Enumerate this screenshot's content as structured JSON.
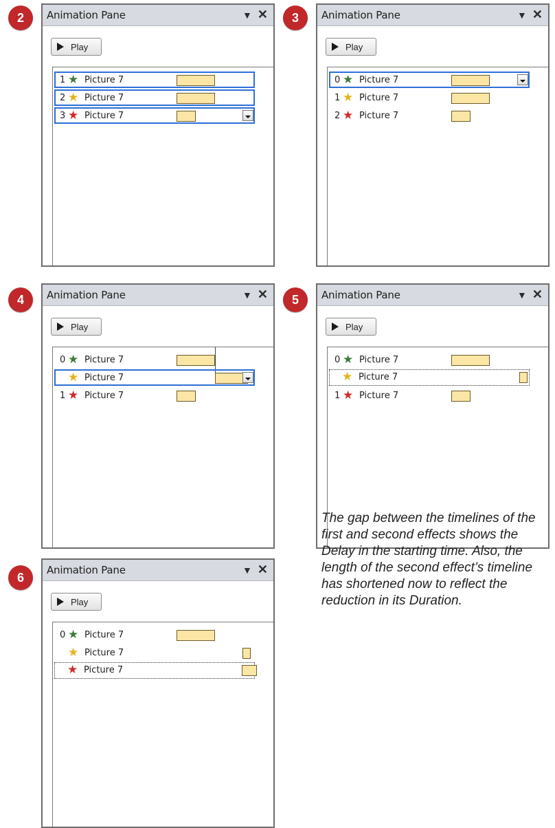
{
  "pane": {
    "title": "Animation Pane",
    "menu_icon": "▼",
    "close_icon": "✕",
    "play_label": "Play",
    "item_label": "Picture 7"
  },
  "steps": [
    "2",
    "3",
    "4",
    "5",
    "6"
  ],
  "panels": [
    {
      "step": "2",
      "rows": [
        {
          "num": "1",
          "star": "green",
          "sel": "blue",
          "dropdown": false
        },
        {
          "num": "2",
          "star": "gold",
          "sel": "blue",
          "dropdown": false
        },
        {
          "num": "3",
          "star": "red",
          "sel": "blue",
          "dropdown": true
        }
      ]
    },
    {
      "step": "3",
      "rows": [
        {
          "num": "0",
          "star": "green",
          "sel": "blue",
          "dropdown": true
        },
        {
          "num": "1",
          "star": "gold",
          "sel": "none",
          "dropdown": false
        },
        {
          "num": "2",
          "star": "red",
          "sel": "none",
          "dropdown": false
        }
      ]
    },
    {
      "step": "4",
      "rows": [
        {
          "num": "0",
          "star": "green",
          "sel": "none",
          "dropdown": false
        },
        {
          "num": "",
          "star": "gold",
          "sel": "blue",
          "dropdown": true
        },
        {
          "num": "1",
          "star": "red",
          "sel": "none",
          "dropdown": false
        }
      ]
    },
    {
      "step": "5",
      "rows": [
        {
          "num": "0",
          "star": "green",
          "sel": "none",
          "dropdown": false
        },
        {
          "num": "",
          "star": "gold",
          "sel": "dotted",
          "dropdown": false
        },
        {
          "num": "1",
          "star": "red",
          "sel": "none",
          "dropdown": false
        }
      ]
    },
    {
      "step": "6",
      "rows": [
        {
          "num": "0",
          "star": "green",
          "sel": "none",
          "dropdown": false
        },
        {
          "num": "",
          "star": "gold",
          "sel": "none",
          "dropdown": false
        },
        {
          "num": "",
          "star": "red",
          "sel": "dotted",
          "dropdown": false
        }
      ]
    }
  ],
  "caption": "The gap between the timelines of the first and second effects shows the Delay in the starting time. Also, the length of the second effect’s timeline has shortened now to reflect the reduction in its Duration.",
  "colors": {
    "step_badge": "#c0282a",
    "selection_blue": "#2d6fd6",
    "timeline_bar": "#fce6a6",
    "title_bar": "#d7dae0"
  },
  "icons": {
    "star_effect": "star-icon",
    "play": "play-icon",
    "dropdown": "dropdown-arrow-icon"
  }
}
